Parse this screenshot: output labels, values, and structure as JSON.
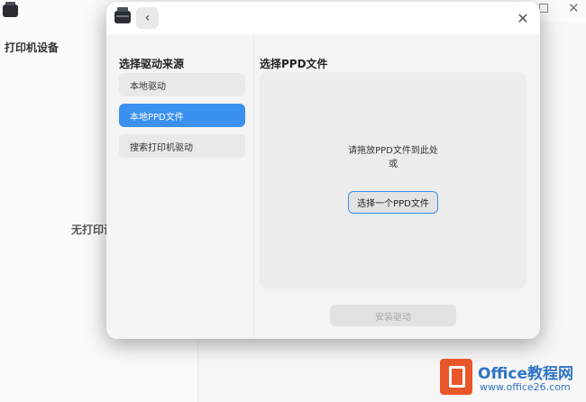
{
  "background": {
    "sidebar_title": "打印机设备",
    "empty_text": "无打印设"
  },
  "dialog": {
    "source_title": "选择驱动来源",
    "sources": [
      {
        "label": "本地驱动",
        "active": false
      },
      {
        "label": "本地PPD文件",
        "active": true
      },
      {
        "label": "搜索打印机驱动",
        "active": false
      }
    ],
    "ppd_title": "选择PPD文件",
    "drop_hint": "请拖放PPD文件到此处",
    "drop_or": "或",
    "choose_button": "选择一个PPD文件",
    "install_button": "安装驱动"
  },
  "watermark": {
    "line1": "Office教程网",
    "line2": "www.office26.com"
  },
  "colors": {
    "accent": "#3b91f0",
    "watermark": "#2f74c6",
    "logo": "#e8562a"
  }
}
